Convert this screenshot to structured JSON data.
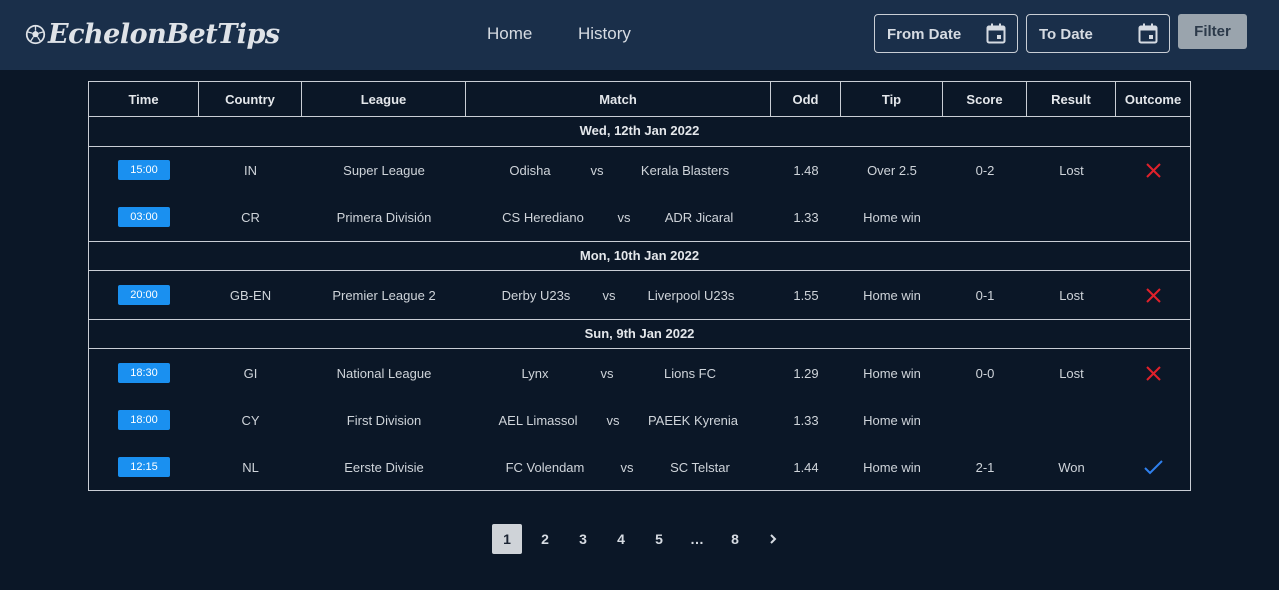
{
  "header": {
    "logo": "EchelonBetTips",
    "nav": {
      "home": "Home",
      "history": "History"
    },
    "from_date": "From Date",
    "to_date": "To Date",
    "filter": "Filter"
  },
  "table": {
    "columns": [
      "Time",
      "Country",
      "League",
      "Match",
      "Odd",
      "Tip",
      "Score",
      "Result",
      "Outcome"
    ],
    "groups": [
      {
        "date": "Wed, 12th Jan 2022",
        "rows": [
          {
            "time": "15:00",
            "country": "IN",
            "league": "Super League",
            "home": "Odisha",
            "vs": "vs",
            "away": "Kerala Blasters",
            "odd": "1.48",
            "tip": "Over 2.5",
            "score": "0-2",
            "result": "Lost",
            "outcome": "cross-icon"
          },
          {
            "time": "03:00",
            "country": "CR",
            "league": "Primera División",
            "home": "CS Herediano",
            "vs": "vs",
            "away": "ADR Jicaral",
            "odd": "1.33",
            "tip": "Home win",
            "score": "",
            "result": "",
            "outcome": ""
          }
        ]
      },
      {
        "date": "Mon, 10th Jan 2022",
        "rows": [
          {
            "time": "20:00",
            "country": "GB-EN",
            "league": "Premier League 2",
            "home": "Derby U23s",
            "vs": "vs",
            "away": "Liverpool U23s",
            "odd": "1.55",
            "tip": "Home win",
            "score": "0-1",
            "result": "Lost",
            "outcome": "cross-icon"
          }
        ]
      },
      {
        "date": "Sun, 9th Jan 2022",
        "rows": [
          {
            "time": "18:30",
            "country": "GI",
            "league": "National League",
            "home": "Lynx",
            "vs": "vs",
            "away": "Lions FC",
            "odd": "1.29",
            "tip": "Home win",
            "score": "0-0",
            "result": "Lost",
            "outcome": "cross-icon"
          },
          {
            "time": "18:00",
            "country": "CY",
            "league": "First Division",
            "home": "AEL Limassol",
            "vs": "vs",
            "away": "PAEEK Kyrenia",
            "odd": "1.33",
            "tip": "Home win",
            "score": "",
            "result": "",
            "outcome": ""
          },
          {
            "time": "12:15",
            "country": "NL",
            "league": "Eerste Divisie",
            "home": "FC Volendam",
            "vs": "vs",
            "away": "SC Telstar",
            "odd": "1.44",
            "tip": "Home win",
            "score": "2-1",
            "result": "Won",
            "outcome": "check-icon"
          }
        ]
      }
    ]
  },
  "pagination": {
    "pages": [
      "1",
      "2",
      "3",
      "4",
      "5",
      "…",
      "8"
    ],
    "active": "1",
    "next_icon": "chevron-right-icon"
  },
  "colors": {
    "background": "#0b1727",
    "header": "#1a2f4a",
    "time_badge": "#1a90f0",
    "lost": "#e0212b",
    "won": "#2f80ed",
    "filter_button": "#9aa4ad"
  }
}
